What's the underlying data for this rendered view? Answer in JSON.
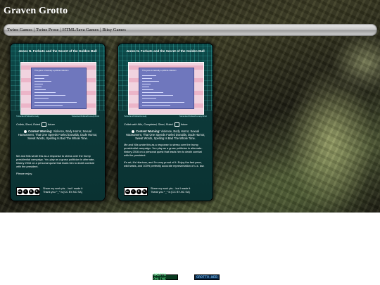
{
  "site": {
    "title": "Graven Grotto"
  },
  "nav": {
    "items": [
      "Twine Games",
      "Twine Prose",
      "HTML/Java Games",
      "Bitsy Games"
    ],
    "separator": "|"
  },
  "cards": [
    {
      "title": "Jones N. Forbuts and the Secret of the Golden Bull",
      "thumb_header": "This game is basically a political collection",
      "tag_left": "Twine/Jam/Political/Comedy",
      "tag_right": "Twine/Jam/Political/Comedy/Short",
      "collab": "Collab, Short, Ruled",
      "collab_end": "future",
      "warning_label": "Content Warning:",
      "warning_text": "Violence, Body Horror, Sexual Harassment, That One Speeds Fueled Donalds, Dude Humor, Sweat Words, Spelling Is Bad The Whole Time.",
      "description": [
        "Me and Nils wrote this as a response to stress over the trump presidential campaign. You play as a gross politician in alternate-history 2016 on a personal quest that leads him to death combat with the president.",
        "Please enjoy."
      ],
      "license_text": "Share my work pls... but I made it",
      "license_thanks": "Thank you ^_^ is [CC BY-NC SA]"
    },
    {
      "title": "Jones N. Forbuts and the Secret of the Golden Bull",
      "thumb_header": "This game is basically a political collection",
      "tag_left": "Twine/Jam/Political/Comedy",
      "tag_right": "Twine/Jam/Political/Comedy/Short",
      "collab": "Collab with Nils, Completed, Short, Ruled",
      "collab_end": "future",
      "warning_label": "Content Warning:",
      "warning_text": "Violence, Body Horror, Sexual Harassment, That One Speeds Fueled Donalds, Dude Humor, Sweat Words, Spelling Is Bad The Whole Time.",
      "description": [
        "Me and Nils wrote this as a response to stress over the trump presidential campaign. You play as a gross politician in alternate-history 2016 on a personal quest that leads him to death combat with the president.",
        "It's art, it's hilarious, and I'm very proud of it. Enjoy the fast pace, wild twists, and 100% perfectly accurate representation of u.s. law."
      ],
      "license_text": "Share my work pls... but I made it",
      "license_thanks": "Thank you ^_^ is [CC BY-NC SA]"
    }
  ],
  "footer": {
    "badge_left": "GROTTO ONLINE",
    "badge_right": "GROTTO.WEB"
  }
}
